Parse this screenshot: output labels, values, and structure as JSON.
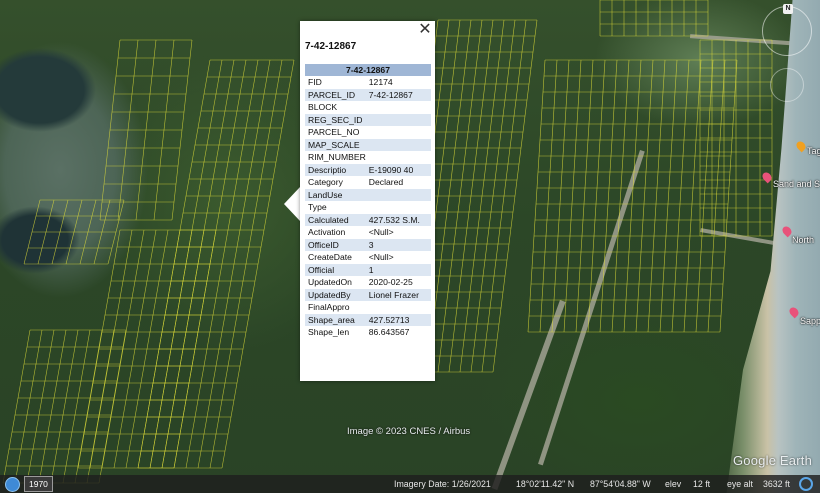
{
  "popup": {
    "close_glyph": "✕",
    "heading": "7-42-12867",
    "table_header": "7-42-12867",
    "rows": [
      {
        "key": "FID",
        "value": "12174"
      },
      {
        "key": "PARCEL_ID",
        "value": "7-42-12867"
      },
      {
        "key": "BLOCK",
        "value": ""
      },
      {
        "key": "REG_SEC_ID",
        "value": ""
      },
      {
        "key": "PARCEL_NO",
        "value": ""
      },
      {
        "key": "MAP_SCALE",
        "value": ""
      },
      {
        "key": "RIM_NUMBER",
        "value": ""
      },
      {
        "key": "Descriptio",
        "value": "E-19090 40"
      },
      {
        "key": "Category",
        "value": "Declared"
      },
      {
        "key": "LandUse",
        "value": ""
      },
      {
        "key": "Type",
        "value": ""
      },
      {
        "key": "Calculated",
        "value": "427.532 S.M."
      },
      {
        "key": "Activation",
        "value": "<Null>"
      },
      {
        "key": "OfficeID",
        "value": "3"
      },
      {
        "key": "CreateDate",
        "value": "<Null>"
      },
      {
        "key": "Official",
        "value": "1"
      },
      {
        "key": "UpdatedOn",
        "value": "2020-02-25"
      },
      {
        "key": "UpdatedBy",
        "value": "Lionel Frazer"
      },
      {
        "key": "FinalAppro",
        "value": ""
      },
      {
        "key": "Shape_area",
        "value": "427.52713"
      },
      {
        "key": "Shape_len",
        "value": "86.643567"
      }
    ]
  },
  "map": {
    "credit": "Image © 2023 CNES / Airbus",
    "logo": "Google Earth",
    "parcel_line_color": "#e4e23a",
    "place_labels": [
      "Tag",
      "Sand and S",
      "North",
      "Sapp"
    ]
  },
  "status_bar": {
    "year": "1970",
    "imagery_date": "Imagery Date: 1/26/2021",
    "latitude": "18°02'11.42\" N",
    "longitude": "87°54'04.88\" W",
    "elev_label": "elev",
    "elev_value": "12 ft",
    "eye_alt_label": "eye alt",
    "eye_alt_value": "3632 ft"
  },
  "navigation": {
    "north_label": "N"
  },
  "icons": {
    "close": "close-icon",
    "historical": "historical-imagery-icon",
    "compass": "compass-icon",
    "pins": [
      "place-pin-icon"
    ]
  }
}
